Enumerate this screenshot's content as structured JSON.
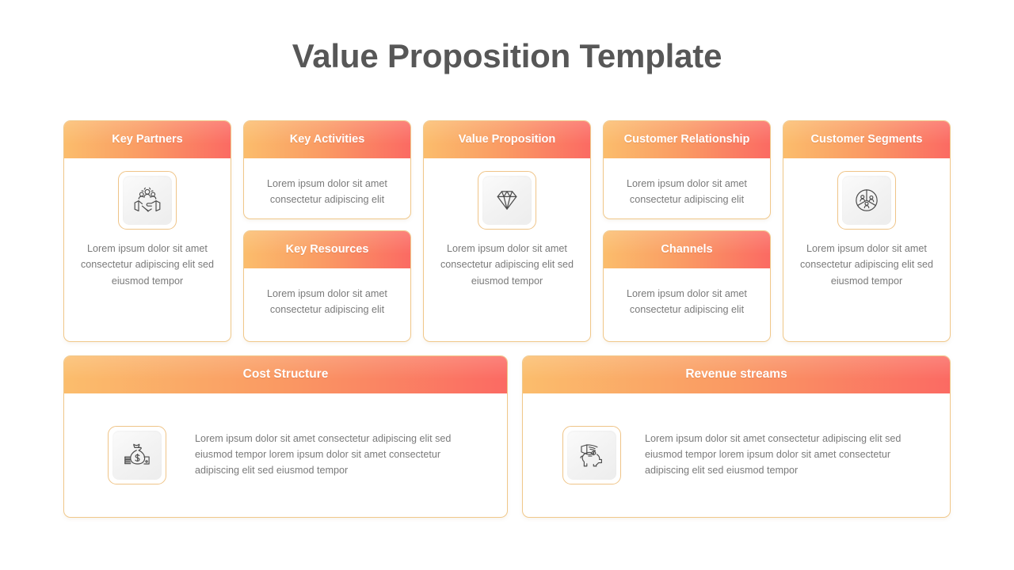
{
  "page": {
    "title": "Value Proposition Template",
    "background_color": "#ffffff",
    "title_color": "#575757",
    "accent_gradient_start": "#fbbd6c",
    "accent_gradient_end": "#fb6a63",
    "card_border_color": "#f0c88a",
    "body_text_color": "#7a7a7a"
  },
  "text": {
    "short": "Lorem ipsum dolor sit amet consectetur adipiscing elit",
    "long": "Lorem ipsum dolor sit amet consectetur adipiscing elit sed  eiusmod tempor",
    "paragraph": "Lorem ipsum dolor sit amet consectetur adipiscing elit sed  eiusmod tempor lorem ipsum dolor sit amet consectetur adipiscing elit sed  eiusmod tempor"
  },
  "columns": [
    {
      "cards": [
        {
          "title": "Key Partners",
          "icon": "handshake-partnership-icon",
          "body": "Lorem ipsum dolor sit amet consectetur adipiscing elit sed  eiusmod tempor"
        }
      ]
    },
    {
      "cards": [
        {
          "title": "Key Activities",
          "icon": null,
          "body": "Lorem ipsum dolor sit amet consectetur adipiscing elit"
        },
        {
          "title": "Key Resources",
          "icon": null,
          "body": "Lorem ipsum dolor sit amet consectetur adipiscing elit"
        }
      ]
    },
    {
      "cards": [
        {
          "title": "Value Proposition",
          "icon": "diamond-gem-icon",
          "body": "Lorem ipsum dolor sit amet consectetur adipiscing elit sed  eiusmod tempor"
        }
      ]
    },
    {
      "cards": [
        {
          "title": "Customer Relationship",
          "icon": null,
          "body": "Lorem ipsum dolor sit amet consectetur adipiscing elit"
        },
        {
          "title": "Channels",
          "icon": null,
          "body": "Lorem ipsum dolor sit amet consectetur adipiscing elit"
        }
      ]
    },
    {
      "cards": [
        {
          "title": "Customer Segments",
          "icon": "segmented-audience-icon",
          "body": "Lorem ipsum dolor sit amet consectetur adipiscing elit sed  eiusmod tempor"
        }
      ]
    }
  ],
  "bottom": [
    {
      "title": "Cost Structure",
      "icon": "money-bag-icon",
      "body": "Lorem ipsum dolor sit amet consectetur adipiscing elit sed  eiusmod tempor lorem ipsum dolor sit amet consectetur adipiscing elit sed  eiusmod tempor"
    },
    {
      "title": "Revenue streams",
      "icon": "piggy-bank-coin-icon",
      "body": "Lorem ipsum dolor sit amet consectetur adipiscing elit sed  eiusmod tempor lorem ipsum dolor sit amet consectetur adipiscing elit sed  eiusmod tempor"
    }
  ]
}
